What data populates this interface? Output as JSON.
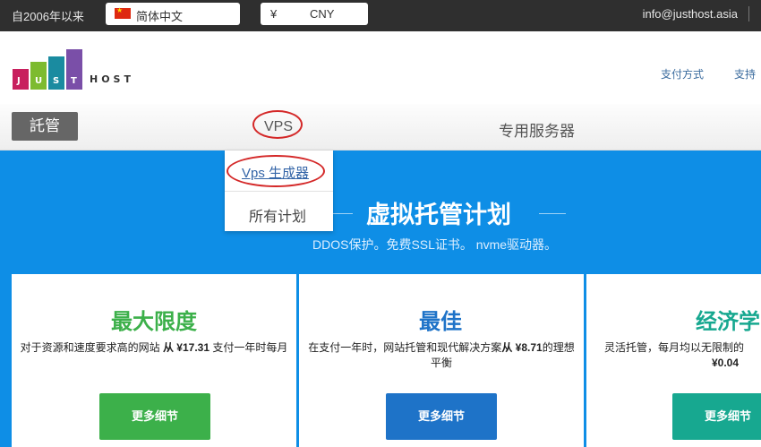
{
  "topbar": {
    "since_text": "自2006年以来",
    "language": "简体中文",
    "currency_symbol": "¥",
    "currency": "CNY",
    "email": "info@justhost.asia"
  },
  "logo": {
    "letters": [
      "J",
      "U",
      "S",
      "T"
    ],
    "suffix": "HOST"
  },
  "header_links": [
    "支付方式",
    "支持"
  ],
  "nav": {
    "hosting": "託管",
    "vps": "VPS",
    "dedicated": "专用服务器"
  },
  "dropdown": {
    "vps_builder": "Vps 生成器",
    "all_plans": "所有计划"
  },
  "hero": {
    "title": "虚拟托管计划",
    "subtitle": "DDOS保护。免费SSL证书。 nvme驱动器。"
  },
  "cards": [
    {
      "title": "最大限度",
      "desc_pre": "对于资源和速度要求高的网站",
      "desc_price": "从 ¥17.31",
      "desc_post": "支付一年时每月",
      "button": "更多细节"
    },
    {
      "title": "最佳",
      "desc_pre": "在支付一年时，网站托管和现代解决方案",
      "desc_price": "从 ¥8.71",
      "desc_post": "的理想平衡",
      "button": "更多细节"
    },
    {
      "title": "经济学",
      "desc_pre": "灵活托管，每月均以无限制的",
      "desc_price": "¥0.04",
      "desc_post": "",
      "button": "更多细节"
    }
  ],
  "colors": {
    "topbar_bg": "#2f2f2f",
    "hero_bg": "#0e8ee6",
    "highlight_circle": "#d42828",
    "card1_accent": "#3cb04a",
    "card2_accent": "#1e73c8",
    "card3_accent": "#17a890"
  },
  "icons": {
    "flag": "china-flag-icon"
  }
}
